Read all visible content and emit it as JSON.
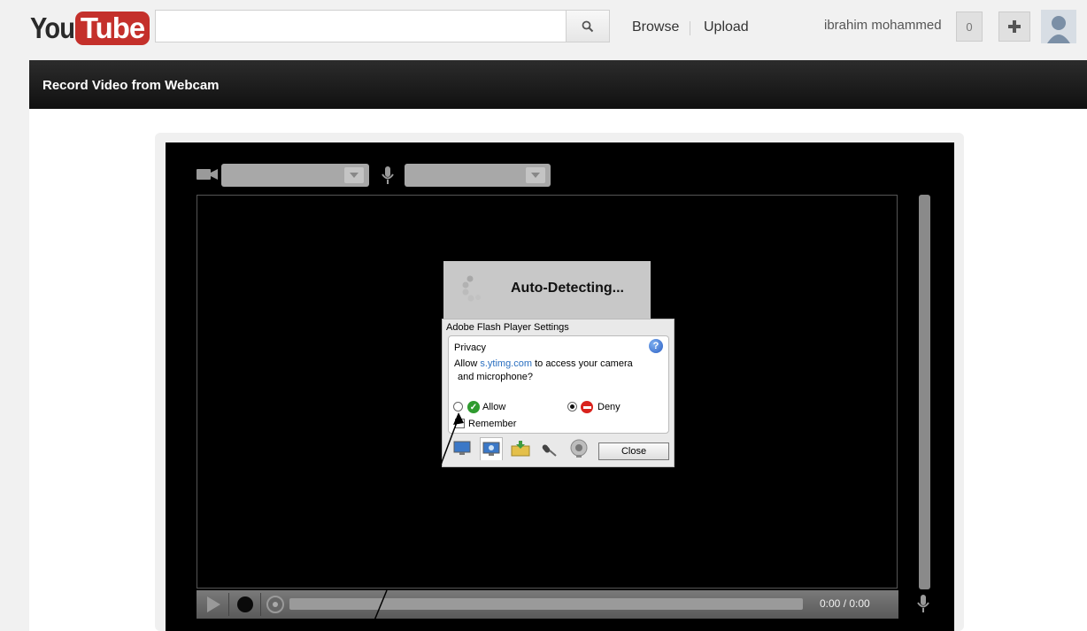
{
  "header": {
    "logo_you": "You",
    "logo_tube": "Tube",
    "search_placeholder": "",
    "browse": "Browse",
    "upload": "Upload",
    "username": "ibrahim mohammed",
    "notification_count": "0"
  },
  "page": {
    "title": "Record Video from Webcam"
  },
  "recorder": {
    "camera_select_value": "",
    "mic_select_value": "",
    "status": "Auto-Detecting...",
    "time": "0:00 / 0:00"
  },
  "flash_dialog": {
    "title": "Adobe Flash Player Settings",
    "section": "Privacy",
    "message_prefix": "Allow ",
    "domain": "s.ytimg.com",
    "message_suffix": " to access your camera",
    "message_line2": "and microphone?",
    "allow_label": "Allow",
    "deny_label": "Deny",
    "remember_label": "Remember",
    "close_label": "Close",
    "selected_option": "Deny",
    "remember_checked": false
  },
  "colors": {
    "brand_red": "#c4302b",
    "titlebar": "#1a1a1a",
    "allow_green": "#2f9b2f",
    "deny_red": "#d9221c",
    "link_blue": "#2a6fc0"
  },
  "icons": [
    "search-icon",
    "plus-icon",
    "avatar-icon",
    "camera-icon",
    "microphone-icon",
    "help-icon",
    "allow-check-icon",
    "deny-icon",
    "play-icon",
    "record-icon"
  ]
}
